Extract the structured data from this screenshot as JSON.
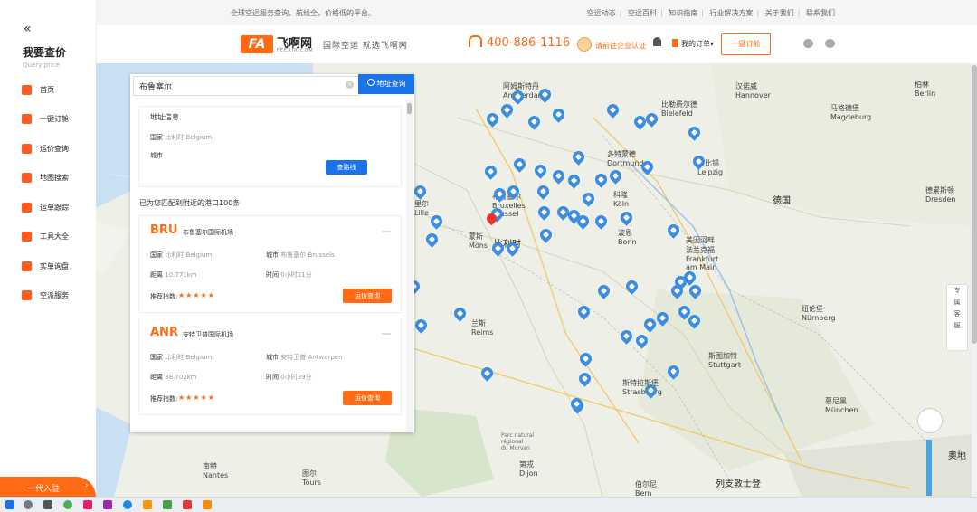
{
  "topbar": {
    "tagline": "全球空运服务查询，航线全，价格低的平台。",
    "links": [
      "空运动态",
      "空运百科",
      "知识指南",
      "行业解决方案",
      "关于我们",
      "联系我们"
    ]
  },
  "header": {
    "logo_mark": "FA",
    "logo_name": "飞啊网",
    "logo_domain": "FEEAIR.COM",
    "slogan": "国际空运  就选飞啊网",
    "phone": "400-886-1116",
    "cert_text": "请前往企业认证",
    "orders_label": "我的订单",
    "one_key_label": "一键订舱"
  },
  "sidebar": {
    "title": "我要查价",
    "subtitle": "Query price",
    "items": [
      {
        "label": "首页"
      },
      {
        "label": "一键订舱"
      },
      {
        "label": "运价查询"
      },
      {
        "label": "地图搜索"
      },
      {
        "label": "运单跟踪"
      },
      {
        "label": "工具大全"
      },
      {
        "label": "实单询盘"
      },
      {
        "label": "空派服务"
      }
    ],
    "agent_label": "一代入驻"
  },
  "search": {
    "value": "布鲁塞尔",
    "button_label": "地址查询"
  },
  "address_card": {
    "title": "地址信息",
    "country_label": "国家",
    "country_value": "比利时 Belgium",
    "city_label": "城市",
    "route_button": "查路线"
  },
  "match_text": "已为您匹配到附近的港口100条",
  "ports": [
    {
      "code": "BRU",
      "name": "布鲁塞尔国际机场",
      "country_label": "国家",
      "country": "比利时 Belgium",
      "city_label": "城市",
      "city": "布鲁塞尔 Brussels",
      "distance_label": "距离",
      "distance": "10.771km",
      "time_label": "时间",
      "time": "0小时11分",
      "rating_label": "推荐指数:",
      "stars": "★★★★★",
      "query_button": "运价查询"
    },
    {
      "code": "ANR",
      "name": "安特卫普国际机场",
      "country_label": "国家",
      "country": "比利时 Belgium",
      "city_label": "城市",
      "city": "安特卫普 Antwerpen",
      "distance_label": "距离",
      "distance": "38.702km",
      "time_label": "时间",
      "time": "0小时39分",
      "rating_label": "推荐指数:",
      "stars": "★★★★★",
      "query_button": "运价查询"
    }
  ],
  "map_labels": {
    "amsterdam": "阿姆斯特丹\nAmsterdam",
    "hanover": "汉诺威\nHannover",
    "berlin": "柏林\nBerlin",
    "bielefeld": "比勒费尔德\nBielefeld",
    "magdeburg": "马格德堡\nMagdeburg",
    "dortmund": "多特蒙德\nDortmund",
    "leipzig": "莱比锡\nLeipzig",
    "bruxelles": "布鲁塞尔\nBruxelles\nBrussel",
    "koln": "科隆\nKöln",
    "germany": "德国",
    "dresden": "德累斯顿\nDresden",
    "belgium": "比利时",
    "bonn": "波恩\nBonn",
    "frankfurt": "美因河畔\n法兰克福\nFrankfurt\nam Main",
    "nurnberg": "纽伦堡\nNürnberg",
    "stuttgart": "斯图加特\nStuttgart",
    "munchen": "慕尼黑\nMünchen",
    "strasbourg": "斯特拉斯堡\nStrasbourg",
    "reims": "兰斯\nReims",
    "switzerland": "列支敦士登",
    "austria": "奥地",
    "nantes": "南特\nNantes",
    "tours": "图尔\nTours",
    "dijon": "第戎\nDijon",
    "bern": "伯尔尼\nBern",
    "mons": "蒙斯\nMons",
    "lille": "里尔\nLille",
    "park": "Parc natural\nrégional\ndu Morvan"
  },
  "float_panel": [
    "专",
    "属",
    "客",
    "服"
  ],
  "colors": {
    "accent": "#ff6a13",
    "blue": "#1a73e8",
    "pin": "#3b8de0"
  }
}
